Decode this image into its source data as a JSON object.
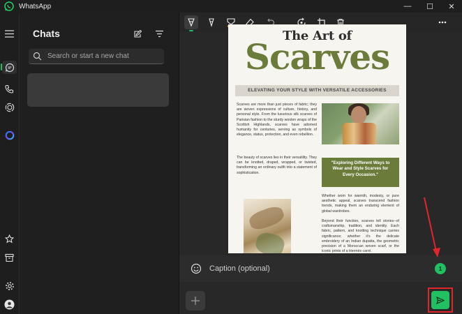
{
  "window": {
    "app_title": "WhatsApp",
    "minimize_glyph": "—",
    "maximize_glyph": "☐",
    "close_glyph": "✕"
  },
  "rail": {
    "items": [
      "menu-icon",
      "chats-icon",
      "calls-icon",
      "status-icon",
      "meta-ai-icon",
      "starred-icon",
      "archived-icon",
      "settings-icon",
      "profile-avatar"
    ]
  },
  "chats": {
    "heading": "Chats",
    "search_placeholder": "Search or start a new chat"
  },
  "toolbar": {
    "tools": [
      "pen-icon",
      "marker-icon",
      "highlighter-icon",
      "eraser-icon",
      "undo-icon",
      "rotate-icon",
      "crop-icon",
      "delete-icon",
      "more-icon"
    ]
  },
  "document": {
    "top_title": "The Art of",
    "big_title": "Scarves",
    "banner": "ELEVATING YOUR STYLE WITH VERSATILE ACCESSORIES",
    "para1": "Scarves are more than just pieces of fabric; they are woven expressions of culture, history, and personal style. From the luxurious silk scarves of Parisian fashion to the sturdy woolen wraps of the Scottish Highlands, scarves have adorned humanity for centuries, serving as symbols of elegance, status, protection, and even rebellion.",
    "para2": "The beauty of scarves lies in their versatility. They can be knotted, draped, wrapped, or twisted, transforming an ordinary outfit into a statement of sophistication.",
    "quote": "\"Exploring Different Ways to Wear and Style Scarves for Every Occasion.\"",
    "para3": "Whether worn for warmth, modesty, or pure aesthetic appeal, scarves transcend fashion trends, making them an enduring element of global wardrobes.",
    "para4": "Beyond their function, scarves tell stories--of craftsmanship, tradition, and identity. Each fabric, pattern, and knotting technique carries significance; whether it's the delicate embroidery of an Indian dupatta, the geometric precision of a Moroccan woven scarf, or the iconic prints of a Hermès carré."
  },
  "caption": {
    "placeholder": "Caption (optional)",
    "view_once_label": "1"
  },
  "colors": {
    "accent_green": "#21c063",
    "highlight_red": "#e0262a",
    "magazine_olive": "#6b7b3a"
  }
}
